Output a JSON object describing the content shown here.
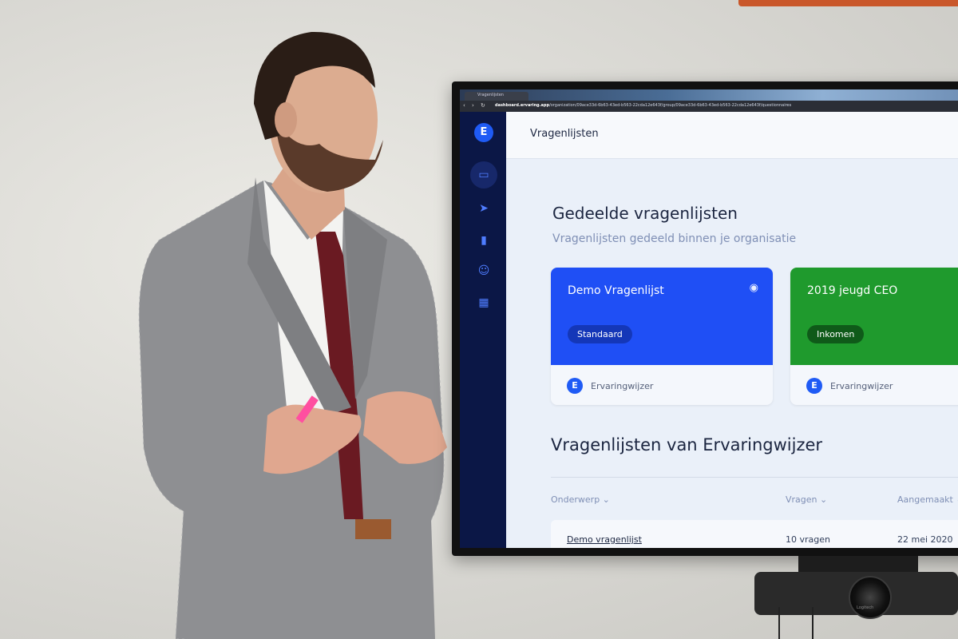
{
  "browser": {
    "tab_title": "Vragenlijsten",
    "url_host": "dashboard.ervaring.app",
    "url_path": "/organization/09ace33d-6b63-43ed-b563-22cda12e643f/group/09ace33d-6b63-43ed-b563-22cda12e643f/questionnaires"
  },
  "app": {
    "logo_letter": "E",
    "header_title": "Vragenlijsten",
    "nav_icons": [
      "inbox-icon",
      "send-icon",
      "bar-chart-icon",
      "users-icon",
      "grid-icon"
    ],
    "shared": {
      "title": "Gedeelde vragenlijsten",
      "subtitle": "Vragenlijsten gedeeld binnen je organisatie",
      "cards": [
        {
          "name": "Demo Vragenlijst",
          "tag": "Standaard",
          "owner": "Ervaringwijzer",
          "color": "#1f4ff5",
          "tag_color": "#1437b8"
        },
        {
          "name": "2019 jeugd CEO",
          "tag": "Inkomen",
          "owner": "Ervaringwijzer",
          "color": "#1f9a2d",
          "tag_color": "#0f5a19"
        }
      ]
    },
    "library": {
      "title": "Vragenlijsten van Ervaringwijzer",
      "columns": {
        "subject": "Onderwerp ⌄",
        "questions": "Vragen ⌄",
        "created": "Aangemaakt ⌄"
      },
      "rows": [
        {
          "subject": "Demo vragenlijst",
          "questions": "10 vragen",
          "created": "22 mei 2020"
        }
      ]
    }
  },
  "camera": {
    "brand": "Logitech"
  },
  "colors": {
    "sidebar": "#0b1746",
    "accent": "#1f5bf5"
  }
}
